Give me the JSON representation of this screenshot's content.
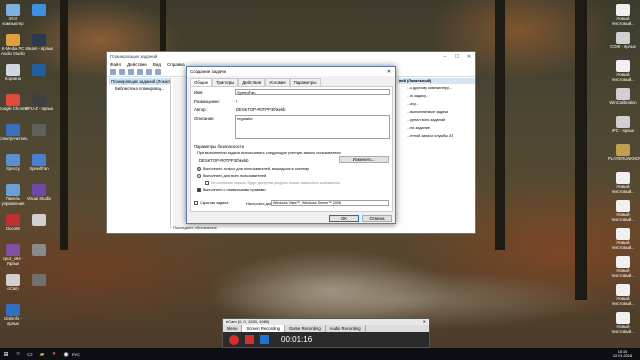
{
  "desktop": {
    "left_icons": [
      {
        "label": "Этот компьютер",
        "color": "#7fb0e0"
      },
      {
        "label": "K-Media PC Audio Studio",
        "color": "#e0a040"
      },
      {
        "label": "Корзина",
        "color": "#cfd8e0"
      },
      {
        "label": "Google Chrome",
        "color": "#e04a3a"
      },
      {
        "label": "Спектрочетель",
        "color": "#3a6fc0"
      },
      {
        "label": "Speccy",
        "color": "#5a8fd0"
      },
      {
        "label": "Панель управления",
        "color": "#6aa0d8"
      },
      {
        "label": "DocoW",
        "color": "#c03030"
      },
      {
        "label": "cpuz_x64 - Ярлык",
        "color": "#8050a0"
      },
      {
        "label": "eCam",
        "color": "#d0d0d0"
      },
      {
        "label": "Diskinfo - ярлык",
        "color": "#3070c0"
      },
      {
        "label": "",
        "color": "#4090e0"
      },
      {
        "label": "Steam - ярлык",
        "color": "#2a3a50"
      },
      {
        "label": "",
        "color": "#2060a0"
      },
      {
        "label": "GPU-Z - ярлык",
        "color": "#404040"
      },
      {
        "label": "",
        "color": "#606060"
      },
      {
        "label": "SpeedFan",
        "color": "#4a7fd0"
      },
      {
        "label": "Visual Studio",
        "color": "#7048a8"
      },
      {
        "label": "",
        "color": "#d0d0d0"
      },
      {
        "label": "",
        "color": "#8a8a8a"
      },
      {
        "label": "",
        "color": "#707070"
      }
    ],
    "right_icons": [
      {
        "label": "Новый текстовый...",
        "color": "#f0f0f0"
      },
      {
        "label": "СОЖ - ярлык",
        "color": "#d0d0d0"
      },
      {
        "label": "Новый текстовый...",
        "color": "#f0f0f0"
      },
      {
        "label": "WinCalibration",
        "color": "#d0d0d0"
      },
      {
        "label": "IPC - ярлык",
        "color": "#d0d0d0"
      },
      {
        "label": "PLAYERUNKNOWN'S",
        "color": "#c0a050"
      },
      {
        "label": "Новый текстовый...",
        "color": "#f0f0f0"
      },
      {
        "label": "Новый текстовый...",
        "color": "#f0f0f0"
      },
      {
        "label": "Новый текстовый...",
        "color": "#f0f0f0"
      },
      {
        "label": "Новый текстовый...",
        "color": "#f0f0f0"
      },
      {
        "label": "Новый текстовый...",
        "color": "#f0f0f0"
      },
      {
        "label": "Новый текстовый...",
        "color": "#f0f0f0"
      }
    ]
  },
  "scheduler": {
    "title": "Планировщик заданий",
    "menu": [
      "Файл",
      "Действие",
      "Вид",
      "Справка"
    ],
    "tree": [
      "Планировщик заданий (Локальный)",
      "Библиотека планировщ..."
    ],
    "actions_header": "ний (Локальный)",
    "actions": [
      "...к другому компьютеру...",
      "...ю задачу...",
      "...ачу...",
      "...выполняемые задачи",
      "...урнал всех заданий",
      "...ни задание",
      "...етной записи службы AT"
    ],
    "bottom_label": "Последнее обновление"
  },
  "dialog": {
    "title": "Создание задачи",
    "tabs": [
      "Общие",
      "Триггеры",
      "Действия",
      "Условия",
      "Параметры"
    ],
    "active_tab": 0,
    "name_label": "Имя:",
    "name_value": "SpeedFan",
    "location_label": "Размещение:",
    "location_value": "\\",
    "author_label": "Автор:",
    "author_value": "DESKTOP-R0TPP30\\kekb",
    "description_label": "Описание:",
    "description_value": "regulator",
    "security_label": "Параметры безопасности",
    "run_as_label": "При выполнении задачи использовать следующую учетную запись пользователя:",
    "run_as_value": "DESKTOP-R0TPP30\\kekb",
    "change_button": "Изменить...",
    "radio1": "Выполнять только для пользователей, вошедших в систему",
    "radio2": "Выполнять для всех пользователей",
    "no_password": "Не сохранять пароль. Будут доступны ресурсы только локального компьютера.",
    "highest": "Выполнить с наивысшими правами",
    "hidden": "Скрытая задача",
    "configure_label": "Настроить для:",
    "configure_value": "Windows Vista™, Windows Server™ 2008",
    "ok": "OK",
    "cancel": "Отмена"
  },
  "ecam": {
    "title": "eCam (0, 0, 1920, 1080)",
    "tabs": [
      "Menu",
      "Screen Recording",
      "Game Recording",
      "Audio Recording"
    ],
    "active_tab": 1,
    "timer": "00:01:16"
  },
  "taskbar": {
    "time": "18:15",
    "date": "22.01.2018",
    "lang": "РУС"
  }
}
